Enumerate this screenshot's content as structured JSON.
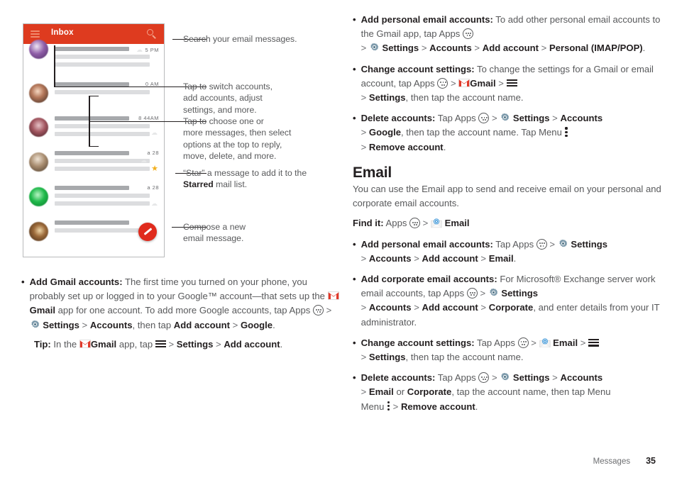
{
  "phone": {
    "header": {
      "title": "Inbox",
      "menu_icon": "hamburger-icon",
      "search_icon": "search-icon"
    },
    "rows": [
      {
        "time": "5 PM",
        "starred": false
      },
      {
        "time": "0   AM",
        "starred": false
      },
      {
        "time": "8 44AM",
        "starred": false
      },
      {
        "time": "a  28",
        "starred": true
      },
      {
        "time": "a  28",
        "starred": false
      },
      {
        "time": "",
        "starred": false
      }
    ],
    "compose_icon": "compose-pencil-icon"
  },
  "callouts": [
    {
      "id": "search",
      "text": "Search your email messages."
    },
    {
      "id": "switch-accounts",
      "line1": "Tap to switch accounts,",
      "line2": "add accounts, adjust",
      "line3": "settings, and more."
    },
    {
      "id": "choose-messages",
      "line1": "Tap to choose one or",
      "line2": "more messages, then select",
      "line3": "options at the top to reply,",
      "line4": "move, delete, and more."
    },
    {
      "id": "star-message",
      "pre": "“Star” a message to add it to the ",
      "bold": "Starred",
      "post": " mail list."
    },
    {
      "id": "compose",
      "line1": "Compose a new",
      "line2": "email message."
    }
  ],
  "left_bullets": {
    "add_gmail": {
      "label": "Add Gmail accounts:",
      "t1": " The first time you turned on your phone, you probably set up or logged in to your Google™ account—that sets up the ",
      "gmail": "Gmail",
      "t2": " app for one account. To add more Google accounts, tap Apps ",
      "gt1": " > ",
      "settings": "Settings",
      "gt2": " > ",
      "accounts": "Accounts",
      "t3": ", then tap ",
      "add_account": "Add account",
      "gt3": " > ",
      "google": "Google",
      "period": "."
    },
    "tip": {
      "label": "Tip:",
      "t1": " In the ",
      "gmail": "Gmail",
      "t2": " app, tap ",
      "gt1": " > ",
      "settings": "Settings",
      "gt2": " > ",
      "add_account": "Add account",
      "period": "."
    }
  },
  "right_bullets_gmail": [
    {
      "label": "Add personal email accounts:",
      "t1": " To add other personal email accounts to the Gmail app, tap Apps ",
      "gt1": " > ",
      "settings": "Settings",
      "gt2": " > ",
      "accounts": "Accounts",
      "gt3": " > ",
      "add_account": "Add account",
      "gt4": " > ",
      "target": "Personal (IMAP/POP)",
      "period": "."
    },
    {
      "label": "Change account settings:",
      "t1": " To change the settings for a Gmail or email account, tap Apps ",
      "gt1": " > ",
      "app": "Gmail",
      "gt2": " > ",
      "gt3": " > ",
      "settings": "Settings",
      "t2": ", then tap the account name."
    },
    {
      "label": "Delete accounts:",
      "t1": " Tap Apps ",
      "gt1": " > ",
      "settings": "Settings",
      "gt2": " > ",
      "accounts": "Accounts",
      "gt3": " >  ",
      "google": "Google",
      "t2": ", then tap the account name. Tap Menu ",
      "gt4": " > ",
      "remove": "Remove account",
      "period": "."
    }
  ],
  "email_section": {
    "heading": "Email",
    "intro": "You can use the Email app to send and receive email on your personal and corporate email accounts.",
    "find_it_label": "Find it:",
    "find_it_apps": " Apps ",
    "find_it_gt": " > ",
    "find_it_app": "Email"
  },
  "right_bullets_email": [
    {
      "label": "Add personal email accounts:",
      "t1": " Tap Apps ",
      "gt1": " > ",
      "settings": "Settings",
      "gt2": " > ",
      "accounts": "Accounts",
      "gt3": " > ",
      "add_account": "Add account",
      "gt4": " > ",
      "target": "Email",
      "period": "."
    },
    {
      "label": "Add corporate email accounts:",
      "t1": " For Microsoft® Exchange server work email accounts, tap Apps ",
      "gt1": " > ",
      "settings": "Settings",
      "gt2": " > ",
      "accounts": "Accounts",
      "gt3": " > ",
      "add_account": "Add account",
      "gt4": " > ",
      "target": "Corporate",
      "t2": ", and enter details from your IT administrator."
    },
    {
      "label": "Change account settings:",
      "t1": " Tap Apps ",
      "gt1": " > ",
      "app": "Email",
      "gt2": " > ",
      "gt3": " > ",
      "settings": "Settings",
      "t2": ", then tap the account name."
    },
    {
      "label": "Delete accounts:",
      "t1": " Tap Apps ",
      "gt1": " > ",
      "settings": "Settings",
      "gt2": " > ",
      "accounts": "Accounts",
      "gt3": " > ",
      "email": "Email",
      "t2": " or ",
      "corporate": "Corporate",
      "t3": ", tap the account name, then tap Menu ",
      "gt4": " > ",
      "remove": "Remove account",
      "period": "."
    }
  ],
  "footer": {
    "chapter": "Messages",
    "page": "35"
  },
  "colors": {
    "header_red": "#de3b1f",
    "fab_red": "#e02b1d",
    "gmail_red": "#e0392a",
    "gear_blue": "#7e9bac",
    "star_gold": "#f2b01e",
    "body_gray": "#58595b",
    "heading_black": "#231f20"
  }
}
